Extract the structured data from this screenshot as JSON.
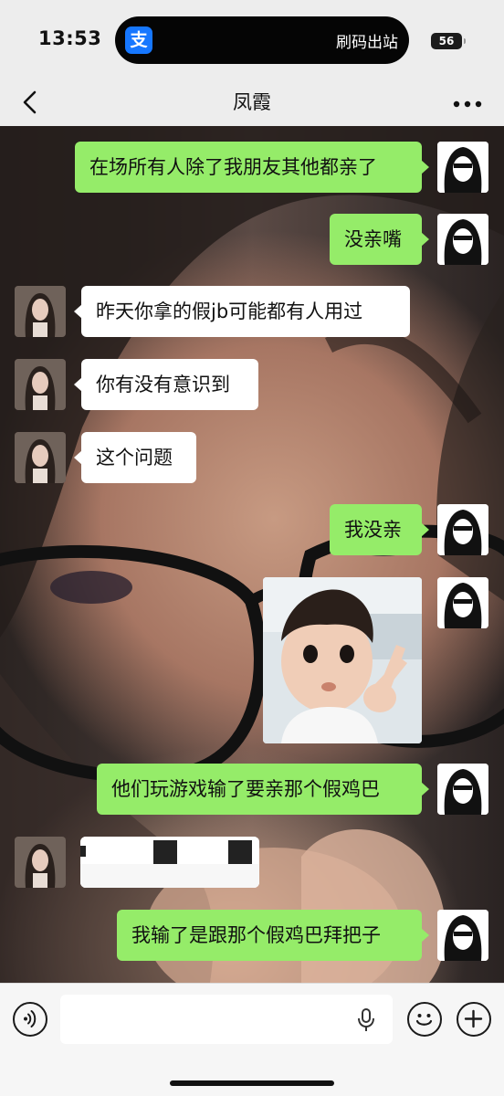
{
  "status_bar": {
    "time": "13:53",
    "island_app_icon": "alipay-icon",
    "island_app_glyph": "支",
    "island_text": "刷码出站",
    "battery": "56"
  },
  "nav": {
    "title": "凤霞",
    "back_icon": "chevron-left-icon",
    "more_icon": "more-dots-icon"
  },
  "messages": [
    {
      "from": "me",
      "text": "在场所有人除了我朋友其他都亲了"
    },
    {
      "from": "me",
      "text": "没亲嘴"
    },
    {
      "from": "other",
      "text": "昨天你拿的假jb可能都有人用过"
    },
    {
      "from": "other",
      "text": "你有没有意识到"
    },
    {
      "from": "other",
      "text": "这个问题"
    },
    {
      "from": "me",
      "text": "我没亲"
    },
    {
      "from": "me",
      "type": "sticker",
      "text": ""
    },
    {
      "from": "me",
      "text": "他们玩游戏输了要亲那个假鸡巴"
    },
    {
      "from": "other",
      "type": "redacted",
      "text": ""
    },
    {
      "from": "me",
      "text": "我输了是跟那个假鸡巴拜把子"
    }
  ],
  "input_bar": {
    "placeholder": "",
    "voice_icon": "voice-icon",
    "mic_icon": "microphone-icon",
    "emoji_icon": "emoji-icon",
    "plus_icon": "plus-icon"
  },
  "colors": {
    "my_bubble": "#95ec69",
    "their_bubble": "#ffffff",
    "background": "#ededed"
  }
}
